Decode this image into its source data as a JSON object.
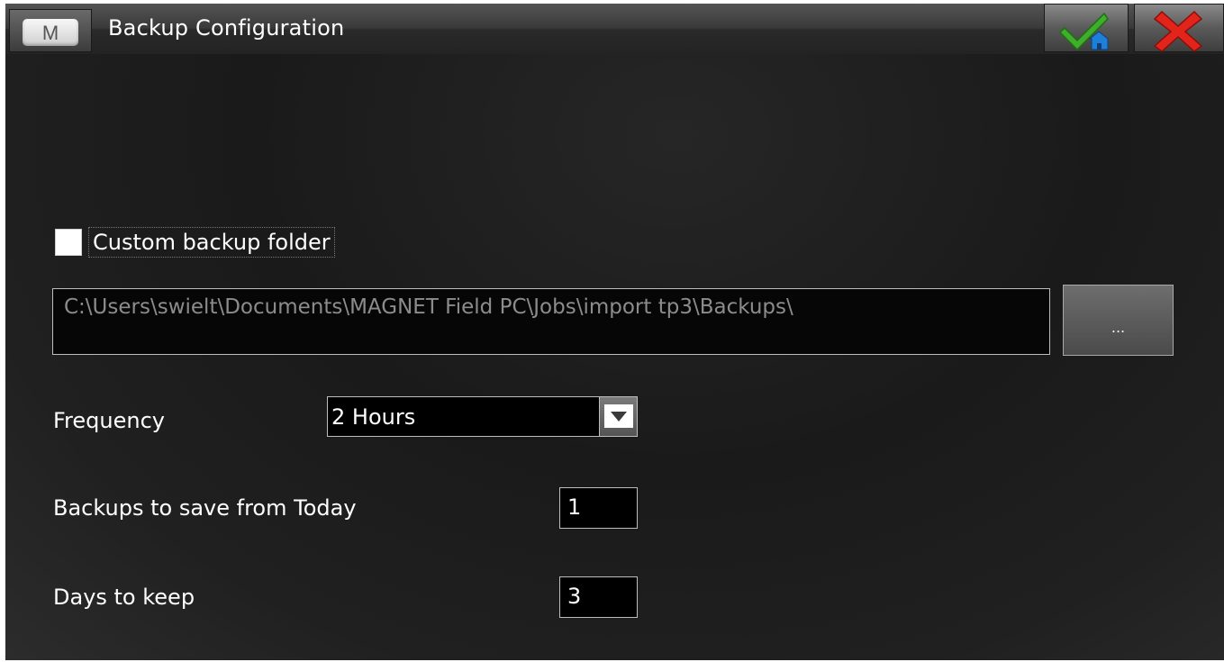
{
  "window": {
    "title": "Backup Configuration",
    "app_button_letter": "M"
  },
  "toolbar": {
    "ok_icon": "check-home-icon",
    "cancel_icon": "red-x-icon"
  },
  "custom_folder": {
    "label": "Custom backup folder",
    "checked": false
  },
  "backup_path": {
    "value": "C:\\Users\\swielt\\Documents\\MAGNET Field PC\\Jobs\\import tp3\\Backups\\",
    "browse_label": "..."
  },
  "frequency": {
    "label": "Frequency",
    "selected": "2 Hours"
  },
  "backups_to_save": {
    "label": "Backups to save from Today",
    "value": "1"
  },
  "days_to_keep": {
    "label": "Days to keep",
    "value": "3"
  },
  "colors": {
    "background": "#1e1e1e",
    "titlebar": "#3a3a3a",
    "check_green": "#3fae2a",
    "close_red": "#e3241b",
    "home_blue": "#1f7fd6"
  }
}
